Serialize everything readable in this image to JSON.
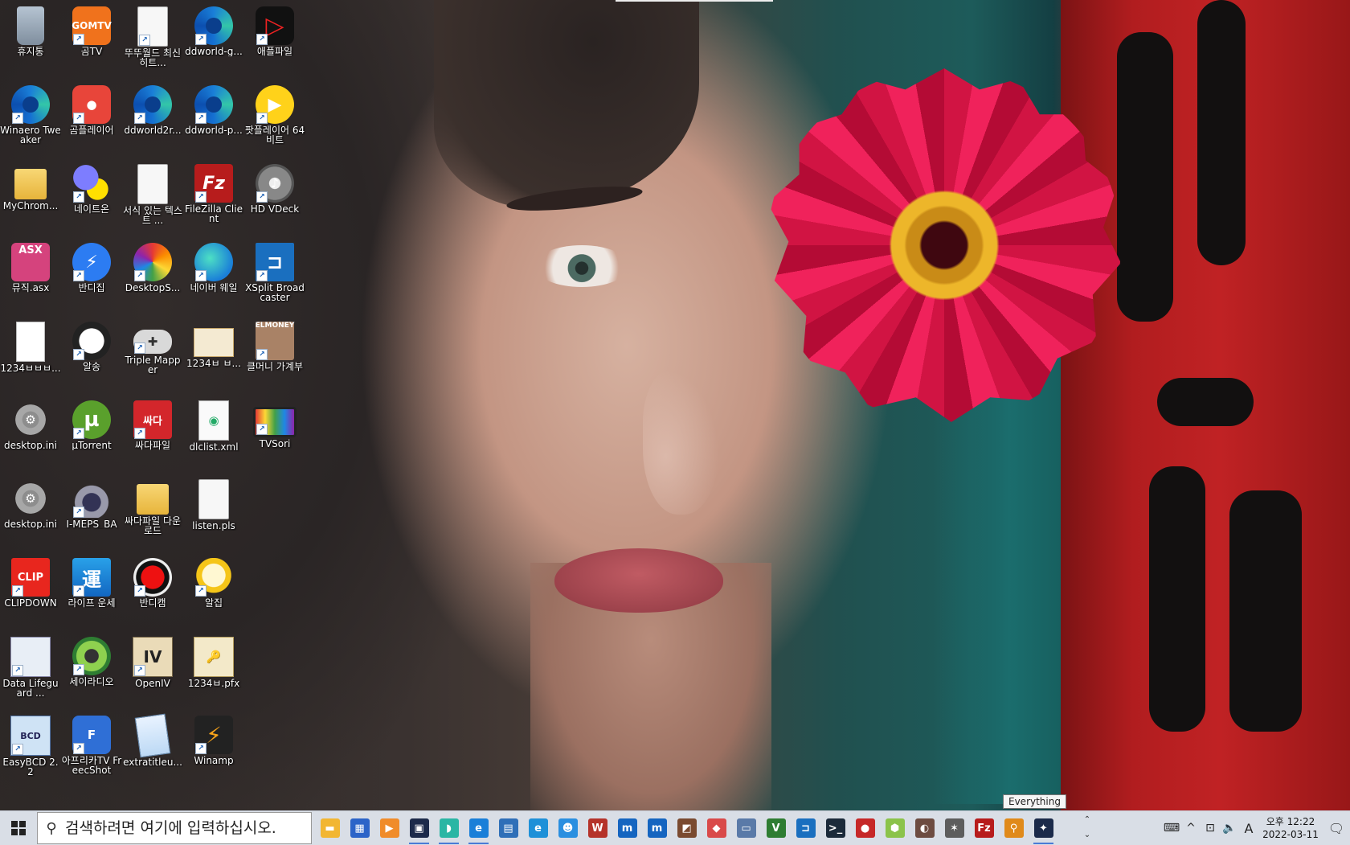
{
  "desktop": {
    "icons": [
      {
        "label": "휴지통",
        "glyph": "",
        "shortcut": false,
        "style": "g-bin",
        "icon": "recycle-bin-icon"
      },
      {
        "label": "곰TV",
        "glyph": "GOMTV",
        "shortcut": true,
        "style": "g-orange",
        "icon": "gomtv-icon"
      },
      {
        "label": "뚜뚜월드 최신히트...",
        "glyph": "",
        "shortcut": true,
        "style": "g-doc",
        "icon": "document-icon"
      },
      {
        "label": "ddworld-g...",
        "glyph": "",
        "shortcut": true,
        "style": "g-edge",
        "icon": "edge-icon"
      },
      {
        "label": "애플파일",
        "glyph": "▷",
        "shortcut": true,
        "style": "g-red-black",
        "icon": "applefile-icon"
      },
      {
        "label": "Winaero Tweaker",
        "glyph": "",
        "shortcut": true,
        "style": "g-edge",
        "icon": "winaero-tweaker-icon"
      },
      {
        "label": "곰플레이어",
        "glyph": "●",
        "shortcut": true,
        "style": "g-red-round",
        "icon": "gom-player-icon"
      },
      {
        "label": "ddworld2r...",
        "glyph": "",
        "shortcut": true,
        "style": "g-edge",
        "icon": "edge-icon"
      },
      {
        "label": "ddworld-p...",
        "glyph": "",
        "shortcut": true,
        "style": "g-edge",
        "icon": "edge-icon"
      },
      {
        "label": "팟플레이어 64 비트",
        "glyph": "▶",
        "shortcut": true,
        "style": "g-yellow-circle",
        "icon": "potplayer-icon"
      },
      {
        "label": "MyChrom...",
        "glyph": "",
        "shortcut": false,
        "style": "g-folder",
        "icon": "folder-icon"
      },
      {
        "label": "네이트온",
        "glyph": "",
        "shortcut": true,
        "style": "g-nateon",
        "icon": "nateon-icon"
      },
      {
        "label": "서식 있는 텍스트 ...",
        "glyph": "",
        "shortcut": false,
        "style": "g-doc",
        "icon": "rich-text-document-icon"
      },
      {
        "label": "FileZilla Client",
        "glyph": "Fz",
        "shortcut": true,
        "style": "g-filezilla",
        "icon": "filezilla-icon"
      },
      {
        "label": "HD VDeck",
        "glyph": "♪",
        "shortcut": true,
        "style": "g-gray-disc",
        "icon": "hd-vdeck-icon"
      },
      {
        "label": "뮤직.asx",
        "glyph": "ASX",
        "shortcut": false,
        "style": "g-asx",
        "icon": "asx-file-icon"
      },
      {
        "label": "반디집",
        "glyph": "⚡",
        "shortcut": true,
        "style": "g-bandizip",
        "icon": "bandizip-icon"
      },
      {
        "label": "DesktopS...",
        "glyph": "",
        "shortcut": true,
        "style": "g-desktops",
        "icon": "desktop-slideshow-icon"
      },
      {
        "label": "네이버 웨일",
        "glyph": "",
        "shortcut": true,
        "style": "g-whale",
        "icon": "naver-whale-icon"
      },
      {
        "label": "XSplit Broadcaster",
        "glyph": "⊐",
        "shortcut": true,
        "style": "g-xsplit",
        "icon": "xsplit-icon"
      },
      {
        "label": "1234ㅂㅂㅂ...",
        "glyph": "",
        "shortcut": false,
        "style": "g-blank",
        "icon": "blank-file-icon"
      },
      {
        "label": "알송",
        "glyph": "♫",
        "shortcut": true,
        "style": "g-panda",
        "icon": "alsong-icon"
      },
      {
        "label": "Triple Mapper",
        "glyph": "✚",
        "shortcut": true,
        "style": "g-gamepad",
        "icon": "gamepad-icon"
      },
      {
        "label": "1234ㅂ ㅂ...",
        "glyph": "",
        "shortcut": false,
        "style": "g-cert",
        "icon": "certificate-icon"
      },
      {
        "label": "클머니 가계부",
        "glyph": "ELMONEY",
        "shortcut": true,
        "style": "g-elmoney",
        "icon": "elmoney-icon"
      },
      {
        "label": "desktop.ini",
        "glyph": "⚙",
        "shortcut": false,
        "style": "g-gear",
        "icon": "settings-file-icon"
      },
      {
        "label": "µTorrent",
        "glyph": "µ",
        "shortcut": true,
        "style": "g-utorrent",
        "icon": "utorrent-icon"
      },
      {
        "label": "싸다파일",
        "glyph": "싸다",
        "shortcut": true,
        "style": "g-ssada",
        "icon": "ssadafile-icon"
      },
      {
        "label": "dlclist.xml",
        "glyph": "◉",
        "shortcut": false,
        "style": "g-xmldoc",
        "icon": "xml-file-icon"
      },
      {
        "label": "TVSori",
        "glyph": "",
        "shortcut": true,
        "style": "g-tv",
        "icon": "tv-icon"
      },
      {
        "label": "desktop.ini",
        "glyph": "⚙",
        "shortcut": false,
        "style": "g-gear",
        "icon": "settings-file-icon"
      },
      {
        "label": "I-MEPS_BA",
        "glyph": "",
        "shortcut": true,
        "style": "g-headset",
        "icon": "headset-icon"
      },
      {
        "label": "싸다파일 다운로드",
        "glyph": "",
        "shortcut": false,
        "style": "g-folder",
        "icon": "folder-icon"
      },
      {
        "label": "listen.pls",
        "glyph": "",
        "shortcut": false,
        "style": "g-doc",
        "icon": "playlist-file-icon"
      },
      {
        "label": "",
        "glyph": "",
        "shortcut": false,
        "style": "",
        "icon": ""
      },
      {
        "label": "CLIPDOWN",
        "glyph": "CLIP",
        "shortcut": true,
        "style": "g-clip",
        "icon": "clipdown-icon"
      },
      {
        "label": "라이프 운세",
        "glyph": "運",
        "shortcut": true,
        "style": "g-life",
        "icon": "fortune-icon"
      },
      {
        "label": "반디캠",
        "glyph": "",
        "shortcut": true,
        "style": "g-rec",
        "icon": "record-icon"
      },
      {
        "label": "알집",
        "glyph": "",
        "shortcut": true,
        "style": "g-alzip",
        "icon": "alzip-icon"
      },
      {
        "label": "",
        "glyph": "",
        "shortcut": false,
        "style": "",
        "icon": ""
      },
      {
        "label": "Data Lifeguard ...",
        "glyph": "",
        "shortcut": true,
        "style": "g-lifeguard",
        "icon": "data-lifeguard-icon"
      },
      {
        "label": "세이라디오",
        "glyph": "",
        "shortcut": true,
        "style": "g-sayradio",
        "icon": "radio-icon"
      },
      {
        "label": "OpenIV",
        "glyph": "IV",
        "shortcut": true,
        "style": "g-openiv",
        "icon": "openiv-icon"
      },
      {
        "label": "1234ㅂ.pfx",
        "glyph": "🔑",
        "shortcut": false,
        "style": "g-pfx",
        "icon": "key-file-icon"
      },
      {
        "label": "",
        "glyph": "",
        "shortcut": false,
        "style": "",
        "icon": ""
      },
      {
        "label": "EasyBCD 2.2",
        "glyph": "BCD",
        "shortcut": true,
        "style": "g-easybcd",
        "icon": "easybcd-icon"
      },
      {
        "label": "아프리카TV FreecShot",
        "glyph": "F",
        "shortcut": true,
        "style": "g-afreeca",
        "icon": "afreecatv-icon"
      },
      {
        "label": "extratitleu...",
        "glyph": "",
        "shortcut": false,
        "style": "g-notepad",
        "icon": "notepad-file-icon"
      },
      {
        "label": "Winamp",
        "glyph": "⚡",
        "shortcut": true,
        "style": "g-winamp",
        "icon": "winamp-icon"
      },
      {
        "label": "",
        "glyph": "",
        "shortcut": false,
        "style": "",
        "icon": ""
      }
    ]
  },
  "taskbar": {
    "search_placeholder": "검색하려면 여기에 입력하십시오.",
    "pinned": [
      {
        "name": "file-explorer",
        "glyph": "▬",
        "color": "#f2b632",
        "running": false
      },
      {
        "name": "store",
        "glyph": "▦",
        "color": "#2c64c8",
        "running": false
      },
      {
        "name": "media-player",
        "glyph": "▶",
        "color": "#f08c2a",
        "running": false
      },
      {
        "name": "monitor-app",
        "glyph": "▣",
        "color": "#1c2a4a",
        "running": true
      },
      {
        "name": "whale-browser",
        "glyph": "◗",
        "color": "#2ab6a4",
        "running": true
      },
      {
        "name": "edge-browser",
        "glyph": "e",
        "color": "#1a7fd8",
        "running": true
      },
      {
        "name": "photos",
        "glyph": "▤",
        "color": "#2f6fb8",
        "running": false
      },
      {
        "name": "internet-explorer",
        "glyph": "e",
        "color": "#1e90d8",
        "running": false
      },
      {
        "name": "people",
        "glyph": "☻",
        "color": "#2a8fe0",
        "running": false
      },
      {
        "name": "winrar",
        "glyph": "W",
        "color": "#b5332a",
        "running": false
      },
      {
        "name": "app-m1",
        "glyph": "m",
        "color": "#1565c0",
        "running": false
      },
      {
        "name": "app-m2",
        "glyph": "m",
        "color": "#1565c0",
        "running": false
      },
      {
        "name": "photo-viewer",
        "glyph": "◩",
        "color": "#7a4a30",
        "running": false
      },
      {
        "name": "tag-app",
        "glyph": "◆",
        "color": "#d94a4a",
        "running": false
      },
      {
        "name": "window-app",
        "glyph": "▭",
        "color": "#5a7aa8",
        "running": false
      },
      {
        "name": "vim",
        "glyph": "V",
        "color": "#2e7d32",
        "running": false
      },
      {
        "name": "xsplit",
        "glyph": "⊐",
        "color": "#1a6fbf",
        "running": false
      },
      {
        "name": "terminal",
        "glyph": ">_",
        "color": "#1b2a3a",
        "running": false
      },
      {
        "name": "bandicam",
        "glyph": "●",
        "color": "#c62828",
        "running": false
      },
      {
        "name": "hex-app",
        "glyph": "⬢",
        "color": "#8bc34a",
        "running": false
      },
      {
        "name": "game-app",
        "glyph": "◐",
        "color": "#6d4c41",
        "running": false
      },
      {
        "name": "bat-app",
        "glyph": "✶",
        "color": "#5d5d5d",
        "running": false
      },
      {
        "name": "filezilla",
        "glyph": "Fz",
        "color": "#b71c1c",
        "running": false
      },
      {
        "name": "everything-search",
        "glyph": "⚲",
        "color": "#e08a1a",
        "running": false
      },
      {
        "name": "star-app",
        "glyph": "✦",
        "color": "#1b2a4a",
        "running": true
      }
    ],
    "tooltip": "Everything",
    "tray": {
      "keyboard": "⌨",
      "expand": "^",
      "network": "⊡",
      "volume": "🔈",
      "ime": "A",
      "period": "오후 12:22",
      "date": "2022-03-11",
      "notifications": "🗨"
    }
  }
}
